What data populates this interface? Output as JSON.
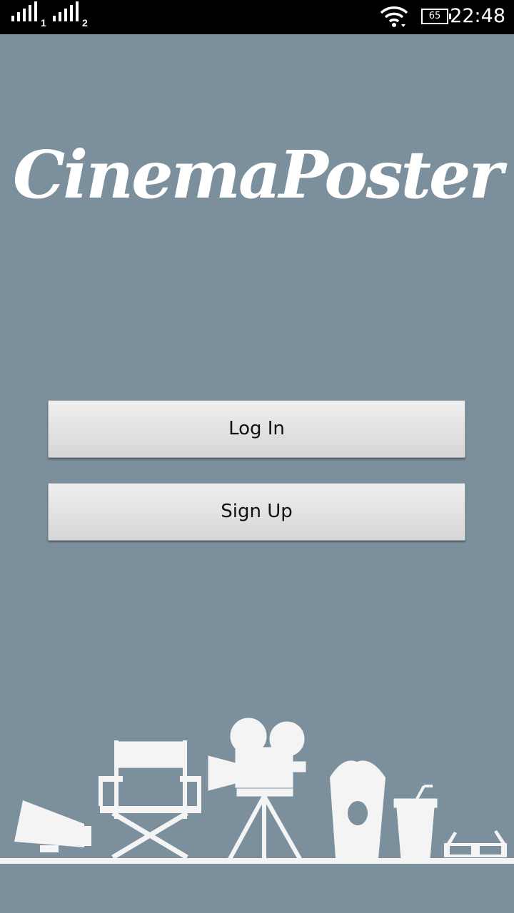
{
  "status_bar": {
    "sim1": "1",
    "sim2": "2",
    "battery": "65",
    "time": "22:48"
  },
  "logo": {
    "text": "CinemaPoster"
  },
  "buttons": {
    "login": "Log In",
    "signup": "Sign Up"
  },
  "colors": {
    "background": "#7b909c",
    "status_bar": "#000000",
    "button_top": "#efefef",
    "button_bottom": "#d6d6d6",
    "illustration": "#f4f4f4"
  },
  "icons": [
    "signal-icon",
    "wifi-icon",
    "battery-icon",
    "megaphone-icon",
    "director-chair-icon",
    "film-camera-icon",
    "popcorn-icon",
    "soda-cup-icon",
    "3d-glasses-icon"
  ]
}
